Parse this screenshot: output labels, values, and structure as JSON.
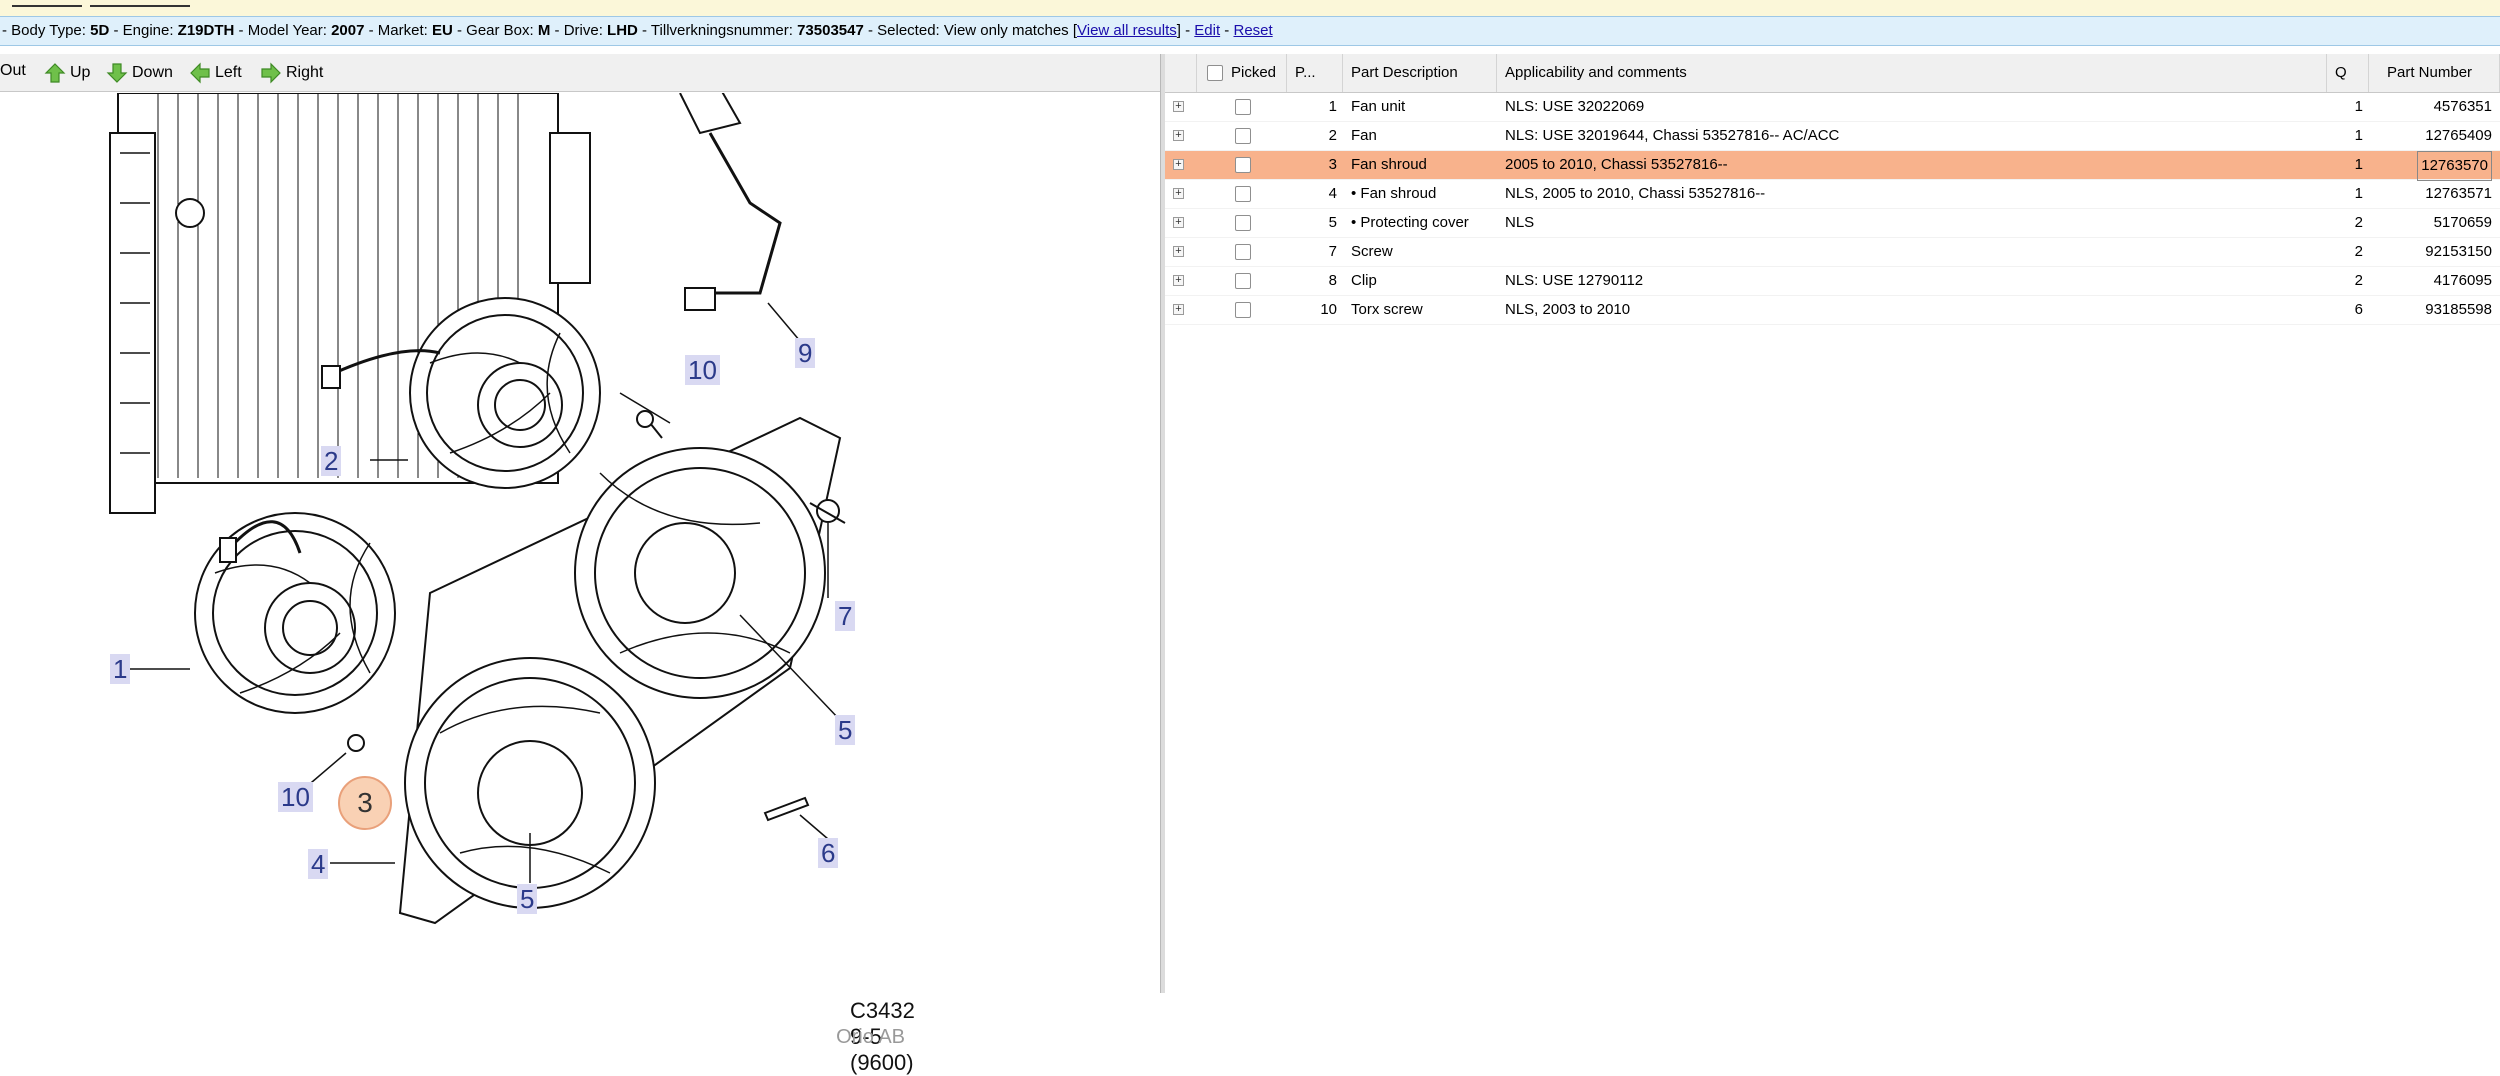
{
  "infobar": {
    "prefix": "- Body Type: ",
    "body_type": "5D",
    "engine_label": " - Engine: ",
    "engine": "Z19DTH",
    "model_year_label": " - Model Year: ",
    "model_year": "2007",
    "market_label": " - Market: ",
    "market": "EU",
    "gearbox_label": " - Gear Box: ",
    "gearbox": "M",
    "drive_label": " - Drive: ",
    "drive": "LHD",
    "tillv_label": " - Tillverkningsnummer: ",
    "tillv": "73503547",
    "selected_label": " - Selected: ",
    "selected_text": "View only matches ",
    "bracket_open": "[",
    "view_all": "View all results",
    "bracket_close": "]",
    "sep1": " - ",
    "edit": "Edit",
    "sep2": " - ",
    "reset": "Reset"
  },
  "nav": {
    "out": "Out",
    "up": "Up",
    "down": "Down",
    "left": "Left",
    "right": "Right"
  },
  "diagram": {
    "callouts": [
      "10",
      "9",
      "2",
      "7",
      "1",
      "5",
      "10",
      "3",
      "6",
      "4",
      "5"
    ],
    "image_code": "C3432 9-5 (9600)",
    "source": "Orio AB"
  },
  "grid": {
    "headers": {
      "picked": "Picked",
      "pos": "P...",
      "description": "Part Description",
      "applicability": "Applicability and comments",
      "qty": "Q",
      "part_number": "Part Number"
    },
    "rows": [
      {
        "pos": "1",
        "desc": "Fan unit",
        "app": "NLS: USE 32022069",
        "qty": "1",
        "pn": "4576351"
      },
      {
        "pos": "2",
        "desc": "Fan",
        "app": "NLS: USE 32019644, Chassi 53527816-- AC/ACC",
        "qty": "1",
        "pn": "12765409"
      },
      {
        "pos": "3",
        "desc": "Fan shroud",
        "app": "2005 to 2010, Chassi 53527816--",
        "qty": "1",
        "pn": "12763570"
      },
      {
        "pos": "4",
        "desc": "• Fan shroud",
        "app": "NLS, 2005 to 2010, Chassi 53527816--",
        "qty": "1",
        "pn": "12763571"
      },
      {
        "pos": "5",
        "desc": "• Protecting cover",
        "app": "NLS",
        "qty": "2",
        "pn": "5170659"
      },
      {
        "pos": "7",
        "desc": "Screw",
        "app": "",
        "qty": "2",
        "pn": "92153150"
      },
      {
        "pos": "8",
        "desc": "Clip",
        "app": "NLS: USE 12790112",
        "qty": "2",
        "pn": "4176095"
      },
      {
        "pos": "10",
        "desc": "Torx screw",
        "app": "NLS, 2003 to 2010",
        "qty": "6",
        "pn": "93185598"
      }
    ]
  }
}
